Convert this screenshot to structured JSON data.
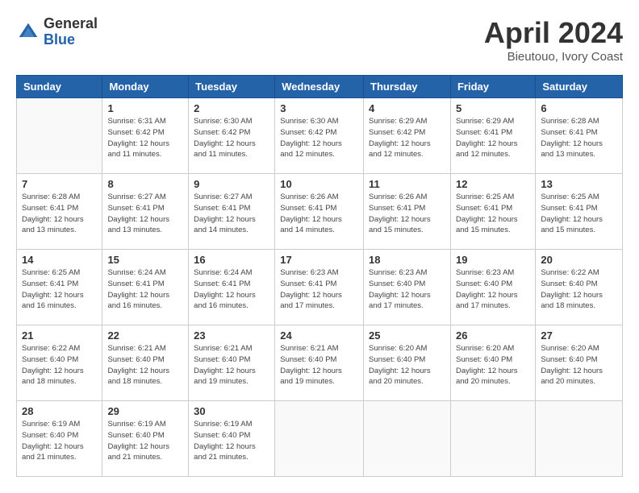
{
  "header": {
    "logo_general": "General",
    "logo_blue": "Blue",
    "title": "April 2024",
    "subtitle": "Bieutouo, Ivory Coast"
  },
  "calendar": {
    "days_of_week": [
      "Sunday",
      "Monday",
      "Tuesday",
      "Wednesday",
      "Thursday",
      "Friday",
      "Saturday"
    ],
    "weeks": [
      [
        {
          "day": "",
          "info": ""
        },
        {
          "day": "1",
          "info": "Sunrise: 6:31 AM\nSunset: 6:42 PM\nDaylight: 12 hours\nand 11 minutes."
        },
        {
          "day": "2",
          "info": "Sunrise: 6:30 AM\nSunset: 6:42 PM\nDaylight: 12 hours\nand 11 minutes."
        },
        {
          "day": "3",
          "info": "Sunrise: 6:30 AM\nSunset: 6:42 PM\nDaylight: 12 hours\nand 12 minutes."
        },
        {
          "day": "4",
          "info": "Sunrise: 6:29 AM\nSunset: 6:42 PM\nDaylight: 12 hours\nand 12 minutes."
        },
        {
          "day": "5",
          "info": "Sunrise: 6:29 AM\nSunset: 6:41 PM\nDaylight: 12 hours\nand 12 minutes."
        },
        {
          "day": "6",
          "info": "Sunrise: 6:28 AM\nSunset: 6:41 PM\nDaylight: 12 hours\nand 13 minutes."
        }
      ],
      [
        {
          "day": "7",
          "info": "Sunrise: 6:28 AM\nSunset: 6:41 PM\nDaylight: 12 hours\nand 13 minutes."
        },
        {
          "day": "8",
          "info": "Sunrise: 6:27 AM\nSunset: 6:41 PM\nDaylight: 12 hours\nand 13 minutes."
        },
        {
          "day": "9",
          "info": "Sunrise: 6:27 AM\nSunset: 6:41 PM\nDaylight: 12 hours\nand 14 minutes."
        },
        {
          "day": "10",
          "info": "Sunrise: 6:26 AM\nSunset: 6:41 PM\nDaylight: 12 hours\nand 14 minutes."
        },
        {
          "day": "11",
          "info": "Sunrise: 6:26 AM\nSunset: 6:41 PM\nDaylight: 12 hours\nand 15 minutes."
        },
        {
          "day": "12",
          "info": "Sunrise: 6:25 AM\nSunset: 6:41 PM\nDaylight: 12 hours\nand 15 minutes."
        },
        {
          "day": "13",
          "info": "Sunrise: 6:25 AM\nSunset: 6:41 PM\nDaylight: 12 hours\nand 15 minutes."
        }
      ],
      [
        {
          "day": "14",
          "info": "Sunrise: 6:25 AM\nSunset: 6:41 PM\nDaylight: 12 hours\nand 16 minutes."
        },
        {
          "day": "15",
          "info": "Sunrise: 6:24 AM\nSunset: 6:41 PM\nDaylight: 12 hours\nand 16 minutes."
        },
        {
          "day": "16",
          "info": "Sunrise: 6:24 AM\nSunset: 6:41 PM\nDaylight: 12 hours\nand 16 minutes."
        },
        {
          "day": "17",
          "info": "Sunrise: 6:23 AM\nSunset: 6:41 PM\nDaylight: 12 hours\nand 17 minutes."
        },
        {
          "day": "18",
          "info": "Sunrise: 6:23 AM\nSunset: 6:40 PM\nDaylight: 12 hours\nand 17 minutes."
        },
        {
          "day": "19",
          "info": "Sunrise: 6:23 AM\nSunset: 6:40 PM\nDaylight: 12 hours\nand 17 minutes."
        },
        {
          "day": "20",
          "info": "Sunrise: 6:22 AM\nSunset: 6:40 PM\nDaylight: 12 hours\nand 18 minutes."
        }
      ],
      [
        {
          "day": "21",
          "info": "Sunrise: 6:22 AM\nSunset: 6:40 PM\nDaylight: 12 hours\nand 18 minutes."
        },
        {
          "day": "22",
          "info": "Sunrise: 6:21 AM\nSunset: 6:40 PM\nDaylight: 12 hours\nand 18 minutes."
        },
        {
          "day": "23",
          "info": "Sunrise: 6:21 AM\nSunset: 6:40 PM\nDaylight: 12 hours\nand 19 minutes."
        },
        {
          "day": "24",
          "info": "Sunrise: 6:21 AM\nSunset: 6:40 PM\nDaylight: 12 hours\nand 19 minutes."
        },
        {
          "day": "25",
          "info": "Sunrise: 6:20 AM\nSunset: 6:40 PM\nDaylight: 12 hours\nand 20 minutes."
        },
        {
          "day": "26",
          "info": "Sunrise: 6:20 AM\nSunset: 6:40 PM\nDaylight: 12 hours\nand 20 minutes."
        },
        {
          "day": "27",
          "info": "Sunrise: 6:20 AM\nSunset: 6:40 PM\nDaylight: 12 hours\nand 20 minutes."
        }
      ],
      [
        {
          "day": "28",
          "info": "Sunrise: 6:19 AM\nSunset: 6:40 PM\nDaylight: 12 hours\nand 21 minutes."
        },
        {
          "day": "29",
          "info": "Sunrise: 6:19 AM\nSunset: 6:40 PM\nDaylight: 12 hours\nand 21 minutes."
        },
        {
          "day": "30",
          "info": "Sunrise: 6:19 AM\nSunset: 6:40 PM\nDaylight: 12 hours\nand 21 minutes."
        },
        {
          "day": "",
          "info": ""
        },
        {
          "day": "",
          "info": ""
        },
        {
          "day": "",
          "info": ""
        },
        {
          "day": "",
          "info": ""
        }
      ]
    ]
  }
}
